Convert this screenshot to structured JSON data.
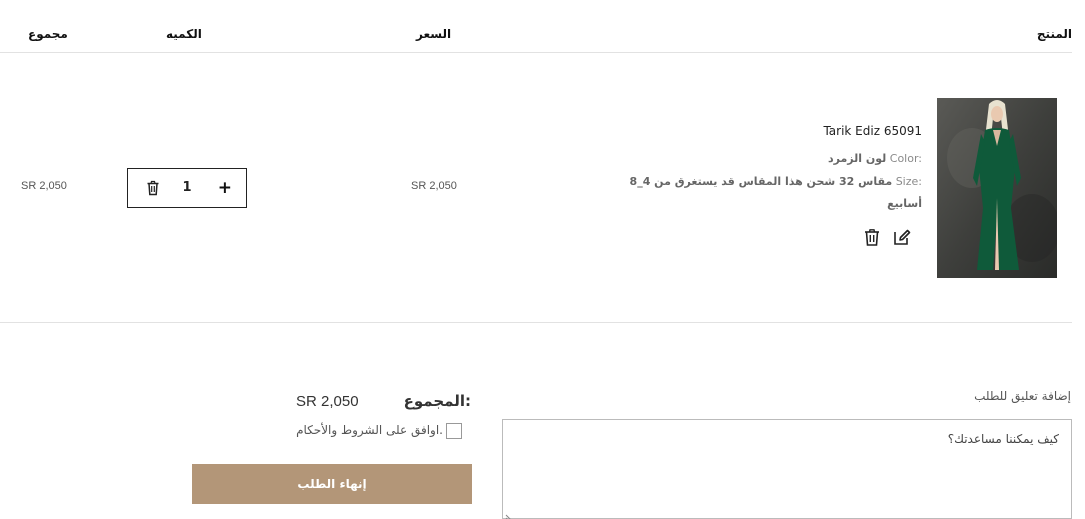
{
  "table_header": {
    "product": "المنتج",
    "price": "السعر",
    "quantity": "الكميه",
    "total": "مجموع"
  },
  "item": {
    "name": "Tarik Ediz 65091",
    "color_key": "Color:",
    "color_value": "لون الزمرد",
    "size_key": "Size:",
    "size_value": "مقاس 32 شحن هذا المقاس قد يستغرق من 4_8",
    "size_value_cont": "أسابيع",
    "price": "SR 2,050",
    "quantity": "1",
    "line_total": "SR 2,050",
    "image_alt": "green gown"
  },
  "summary": {
    "total_label": "المجموع:",
    "total_value": "SR 2,050",
    "terms": "اوافق على الشروط والأحكام.",
    "checkout": "إنهاء الطلب"
  },
  "comment": {
    "label": "إضافة تعليق للطلب",
    "placeholder": "كيف يمكننا مساعدتك؟"
  },
  "colors": {
    "accent": "#b39678",
    "dress": "#0f5a3a"
  },
  "icons": [
    "edit-icon",
    "trash-icon",
    "plus-icon",
    "resize-icon"
  ]
}
